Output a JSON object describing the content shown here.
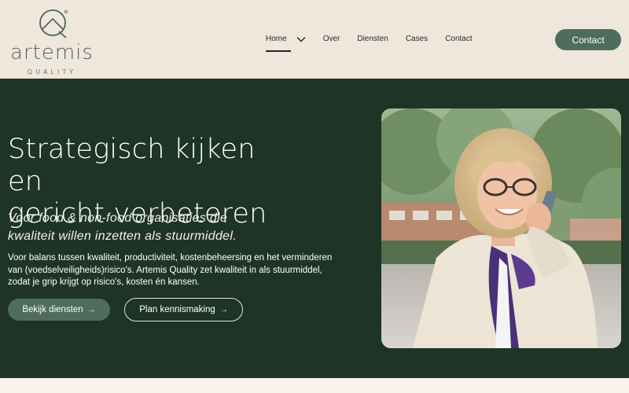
{
  "brand": {
    "name": "artemis",
    "tagline": "QUALITY",
    "accent": "#4f6d5c",
    "dark": "#1d3427",
    "cream": "#efe7dc"
  },
  "nav": {
    "items": [
      {
        "label": "Home",
        "active": true,
        "has_dropdown": true
      },
      {
        "label": "Over"
      },
      {
        "label": "Diensten"
      },
      {
        "label": "Cases"
      },
      {
        "label": "Contact"
      }
    ],
    "cta_label": "Contact",
    "dropdown_icon": "chevron-down-icon"
  },
  "hero": {
    "title_line1": "Strategisch kijken en",
    "title_line2": "gericht verbeteren",
    "subtitle_line1": "Voor food & non-food organisaties die",
    "subtitle_line2": "kwaliteit willen inzetten als stuurmiddel.",
    "body_line1": "Voor balans tussen kwaliteit, productiviteit, kostenbeheersing en het verminderen",
    "body_line2": "van (voedselveiligheids)risico's. Artemis Quality zet kwaliteit in als stuurmiddel,",
    "body_line3": "zodat je grip krijgt op risico's, kosten én kansen.",
    "primary_button": "Bekijk diensten",
    "secondary_button": "Plan kennismaking",
    "arrow": "→"
  }
}
